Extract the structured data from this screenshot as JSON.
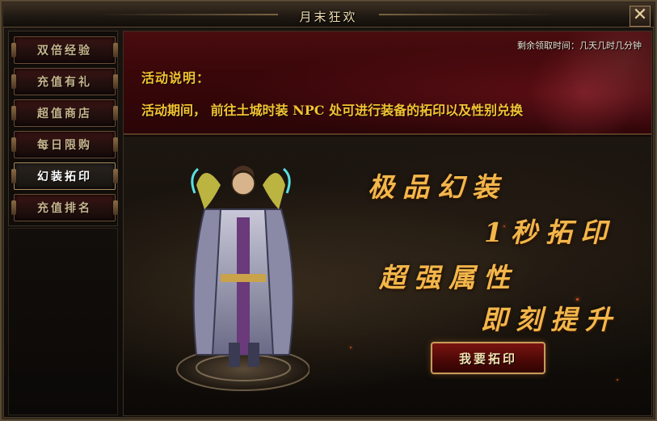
{
  "window": {
    "title": "月末狂欢",
    "close_label": "✕"
  },
  "sidebar": {
    "items": [
      {
        "label": "双倍经验",
        "active": false
      },
      {
        "label": "充值有礼",
        "active": false
      },
      {
        "label": "超值商店",
        "active": false
      },
      {
        "label": "每日限购",
        "active": false
      },
      {
        "label": "幻装拓印",
        "active": true
      },
      {
        "label": "充值排名",
        "active": false
      }
    ]
  },
  "banner": {
    "time_label": "剩余领取时间：几天几时几分钟",
    "desc_title": "活动说明：",
    "desc_text": "活动期间， 前往土城时装 NPC 处可进行装备的拓印以及性别兑换"
  },
  "promo": {
    "line1": "极品幻装",
    "line2": "1秒拓印",
    "line3": "超强属性",
    "line4": "即刻提升",
    "button_label": "我要拓印"
  },
  "colors": {
    "accent_gold": "#f5c332",
    "banner_red": "#3a0709",
    "slogan_gold": "#f3b64a"
  }
}
